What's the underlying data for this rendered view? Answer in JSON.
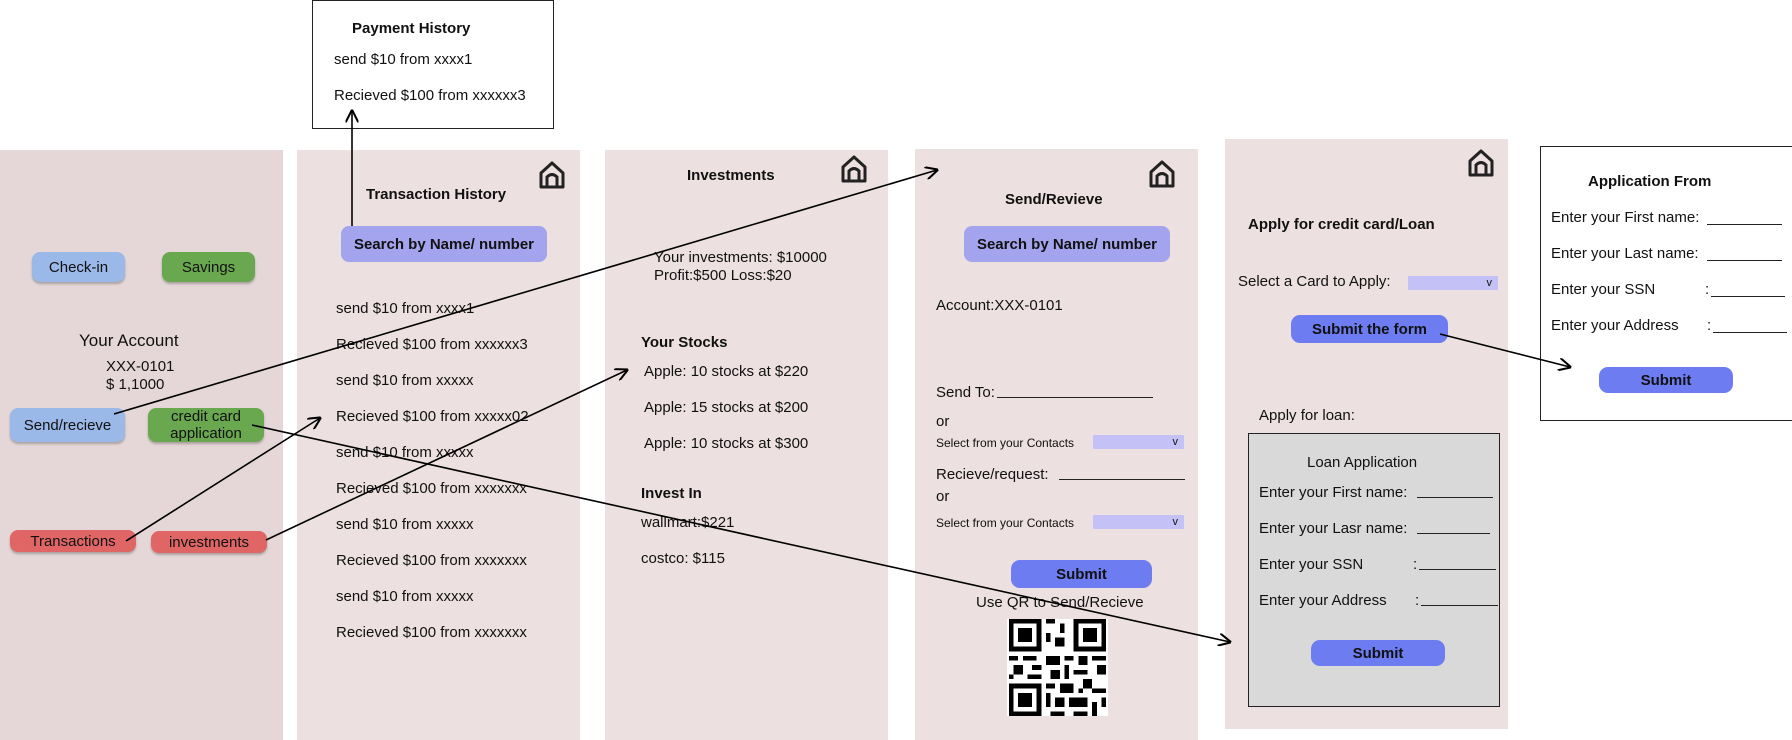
{
  "payment_history": {
    "title": "Payment History",
    "items": [
      "send  $10 from xxxx1",
      "Recieved $100 from xxxxxx3"
    ]
  },
  "account": {
    "checkin_label": "Check-in",
    "savings_label": "Savings",
    "title": "Your Account",
    "number": "XXX-0101",
    "balance": "$ 1,1000",
    "send_receive_label": "Send/recieve",
    "credit_card_label": "credit card application",
    "transactions_label": "Transactions",
    "investments_label": "investments"
  },
  "transactions": {
    "title": "Transaction History",
    "search_label": "Search by Name/ number",
    "items": [
      "send  $10 from xxxx1",
      "Recieved $100 from xxxxxx3",
      "send  $10 from xxxxx",
      "Recieved $100 from xxxxx02",
      "send  $10 from xxxxx",
      "Recieved $100 from xxxxxxx",
      "send  $10 from xxxxx",
      "Recieved $100 from xxxxxxx",
      "send  $10 from xxxxx",
      "Recieved $100 from xxxxxxx"
    ]
  },
  "investments": {
    "title": "Investments",
    "summary_line1": "Your investments: $10000",
    "summary_line2": "Profit:$500   Loss:$20",
    "stocks_title": "Your Stocks",
    "stocks": [
      "Apple: 10 stocks at $220",
      "Apple: 15 stocks at $200",
      "Apple: 10 stocks at $300"
    ],
    "invest_in_title": "Invest In",
    "invest_in": [
      "wallmart:$221",
      "costco:    $115"
    ]
  },
  "send_receive": {
    "title": "Send/Revieve",
    "search_label": "Search by Name/ number",
    "account": "Account:XXX-0101",
    "send_to": "Send To:",
    "or1": "or",
    "select_contacts1": "Select from your Contacts",
    "receive_request": "Recieve/request:",
    "or2": "or",
    "select_contacts2": "Select from your Contacts",
    "dropdown_glyph": "v",
    "submit_label": "Submit",
    "qr_caption": "Use QR to Send/Recieve"
  },
  "apply": {
    "title": "Apply for credit card/Loan",
    "select_card": "Select a Card to Apply:",
    "dropdown_glyph": "v",
    "submit_form_label": "Submit the form",
    "apply_loan": "Apply for loan:",
    "loan_title": "Loan Application",
    "loan_fields": [
      "Enter your First name:",
      "Enter your Lasr name:",
      "Enter your SSN",
      "Enter your Address"
    ],
    "submit_label": "Submit"
  },
  "application_form": {
    "title": "Application From",
    "fields": [
      "Enter your First name:",
      "Enter your Last name:",
      "Enter your SSN",
      "Enter your Address"
    ],
    "submit_label": "Submit"
  },
  "colors": {
    "panel_bg": "#ece0e0",
    "blue_button": "#9ab8e8",
    "green_button": "#6aa84f",
    "red_button": "#e06666",
    "search_button": "#a4a4ee",
    "submit_button": "#6d7cf0",
    "dropdown": "#c3c1f5"
  },
  "icons": [
    "home-icon",
    "qr-code-icon",
    "arrow"
  ]
}
